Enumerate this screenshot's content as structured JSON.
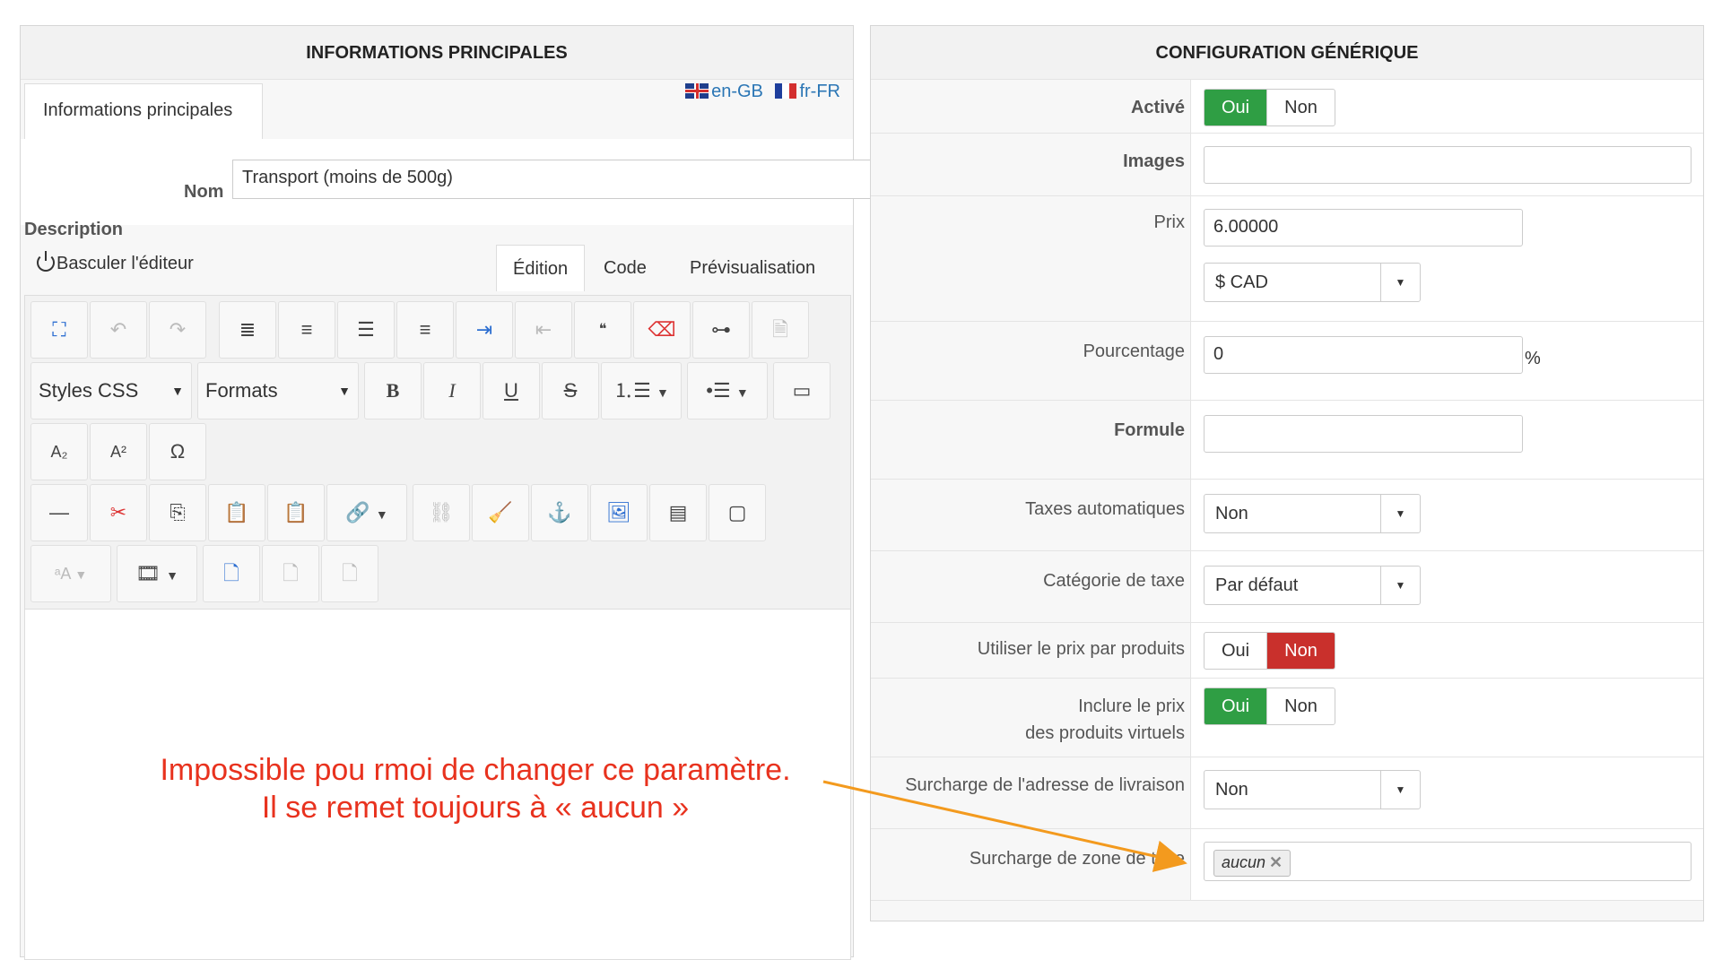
{
  "left_panel": {
    "title": "INFORMATIONS PRINCIPALES",
    "tab_label": "Informations principales",
    "languages": [
      "en-GB",
      "fr-FR"
    ],
    "name_label": "Nom",
    "name_value": "Transport (moins de 500g)",
    "description_label": "Description",
    "toggle_editor": "Basculer l'éditeur",
    "editor_tabs": [
      "Édition",
      "Code",
      "Prévisualisation"
    ],
    "styles_dropdown": "Styles CSS",
    "formats_dropdown": "Formats"
  },
  "right_panel": {
    "title": "CONFIGURATION GÉNÉRIQUE",
    "active_label": "Activé",
    "images_label": "Images",
    "price_label": "Prix",
    "price_value": "6.00000",
    "currency_value": "$ CAD",
    "percentage_label": "Pourcentage",
    "percentage_value": "0",
    "percent_sign": "%",
    "formula_label": "Formule",
    "auto_taxes_label": "Taxes automatiques",
    "auto_taxes_value": "Non",
    "tax_category_label": "Catégorie de taxe",
    "tax_category_value": "Par défaut",
    "use_product_price_label": "Utiliser le prix par produits",
    "include_price_label_line1": "Inclure le prix",
    "include_price_label_line2": "des produits virtuels",
    "shipping_override_label": "Surcharge de l'adresse de livraison",
    "shipping_override_value": "Non",
    "tax_zone_override_label": "Surcharge de zone de taxe",
    "tax_zone_tag": "aucun",
    "yes": "Oui",
    "no": "Non"
  },
  "annotation": {
    "line1": "Impossible pou rmoi de changer ce paramètre.",
    "line2": "Il se remet toujours à « aucun »",
    "color": "#e8321e",
    "arrow_color": "#f39a1e"
  },
  "colors": {
    "active_green": "#2f9e44",
    "active_red": "#c9302c",
    "link_blue": "#2b76b5"
  }
}
